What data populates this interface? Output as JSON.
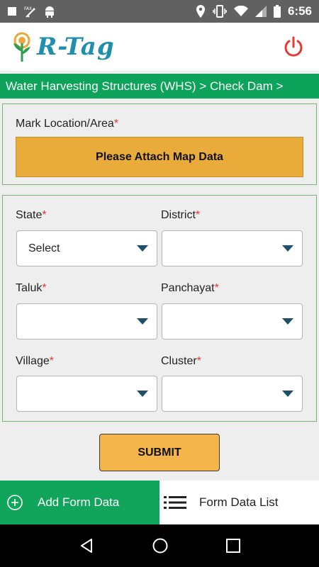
{
  "status_bar": {
    "time": "6:56",
    "left_icons": [
      "stop-icon",
      "fax-icon",
      "android-icon"
    ],
    "right_icons": [
      "location-icon",
      "vibrate-icon",
      "wifi-icon",
      "signal-icon",
      "battery-icon"
    ]
  },
  "header": {
    "logo_text": "R-Tag",
    "power_icon": "power-icon"
  },
  "breadcrumb": "Water Harvesting Structures (WHS) > Check Dam >",
  "location": {
    "label": "Mark Location/Area",
    "required": "*",
    "attach_button": "Please Attach Map Data"
  },
  "form": {
    "state": {
      "label": "State",
      "required": "*",
      "value": "Select"
    },
    "district": {
      "label": "District",
      "required": "*",
      "value": ""
    },
    "taluk": {
      "label": "Taluk",
      "required": "*",
      "value": ""
    },
    "panchayat": {
      "label": "Panchayat",
      "required": "*",
      "value": ""
    },
    "village": {
      "label": "Village",
      "required": "*",
      "value": ""
    },
    "cluster": {
      "label": "Cluster",
      "required": "*",
      "value": ""
    }
  },
  "submit_label": "SUBMIT",
  "bottom_tabs": {
    "add": "Add Form Data",
    "list": "Form Data List"
  },
  "colors": {
    "green": "#0ea35a",
    "accent_orange": "#e9ab3a",
    "required_red": "#e53935",
    "power_red": "#e53935"
  }
}
